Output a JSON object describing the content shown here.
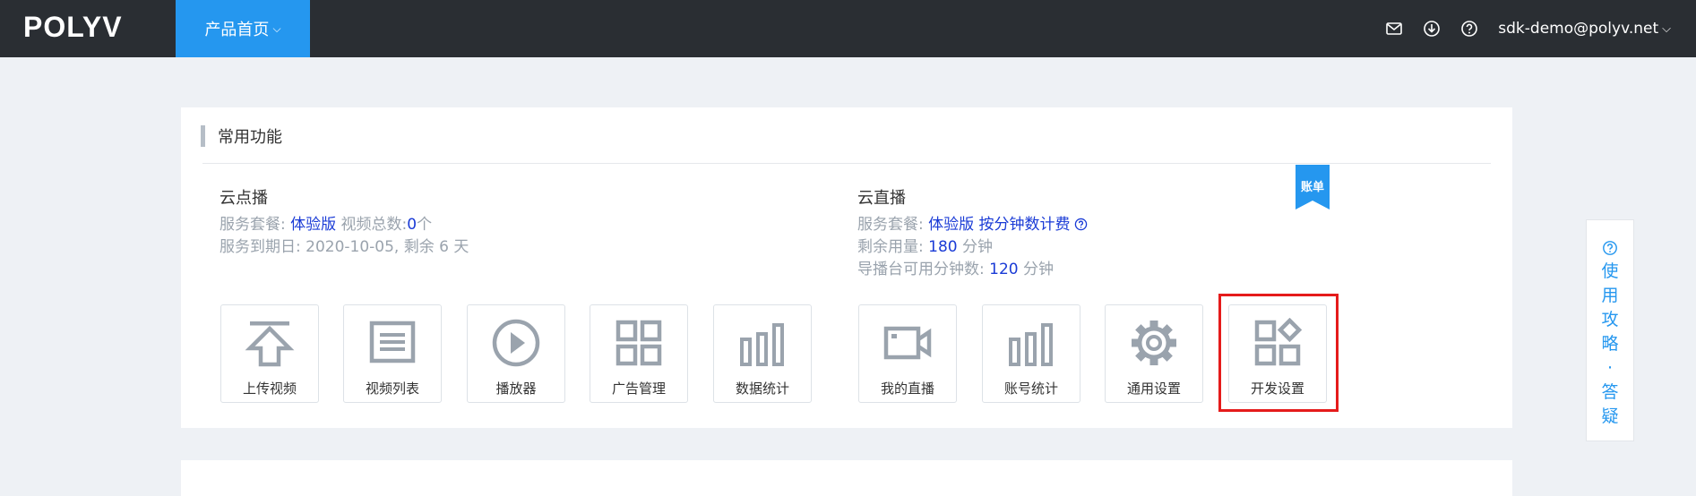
{
  "header": {
    "logo": "POLYV",
    "nav_active": "产品首页",
    "user": "sdk-demo@polyv.net",
    "icons": [
      "mail-icon",
      "download-icon",
      "help-icon"
    ]
  },
  "card": {
    "title": "常用功能",
    "vod": {
      "title": "云点播",
      "plan_label": "服务套餐:",
      "plan_value": "体验版",
      "count_label": "视频总数:",
      "count_value": "0",
      "count_unit": "个",
      "expire": "服务到期日: 2020-10-05, 剩余 6 天",
      "tiles": [
        {
          "label": "上传视频",
          "icon": "upload-icon"
        },
        {
          "label": "视频列表",
          "icon": "list-icon"
        },
        {
          "label": "播放器",
          "icon": "play-icon"
        },
        {
          "label": "广告管理",
          "icon": "grid-icon"
        },
        {
          "label": "数据统计",
          "icon": "bar-chart-icon"
        }
      ]
    },
    "live": {
      "title": "云直播",
      "plan_label": "服务套餐:",
      "plan_value": "体验版 按分钟数计费",
      "remain_label": "剩余用量:",
      "remain_value": "180",
      "remain_unit": "分钟",
      "director_label": "导播台可用分钟数:",
      "director_value": "120",
      "director_unit": "分钟",
      "tiles": [
        {
          "label": "我的直播",
          "icon": "video-camera-icon"
        },
        {
          "label": "账号统计",
          "icon": "bar-chart-icon"
        },
        {
          "label": "通用设置",
          "icon": "gear-icon"
        },
        {
          "label": "开发设置",
          "icon": "dev-settings-icon"
        }
      ]
    },
    "ribbon": "账单"
  },
  "guide": {
    "text": "使用攻略·答疑"
  },
  "colors": {
    "topbar": "#2a2e33",
    "accent": "#2597ef",
    "value": "#1a3bd6",
    "highlight": "#e51b1b",
    "icon_gray": "#9aa3ad"
  }
}
